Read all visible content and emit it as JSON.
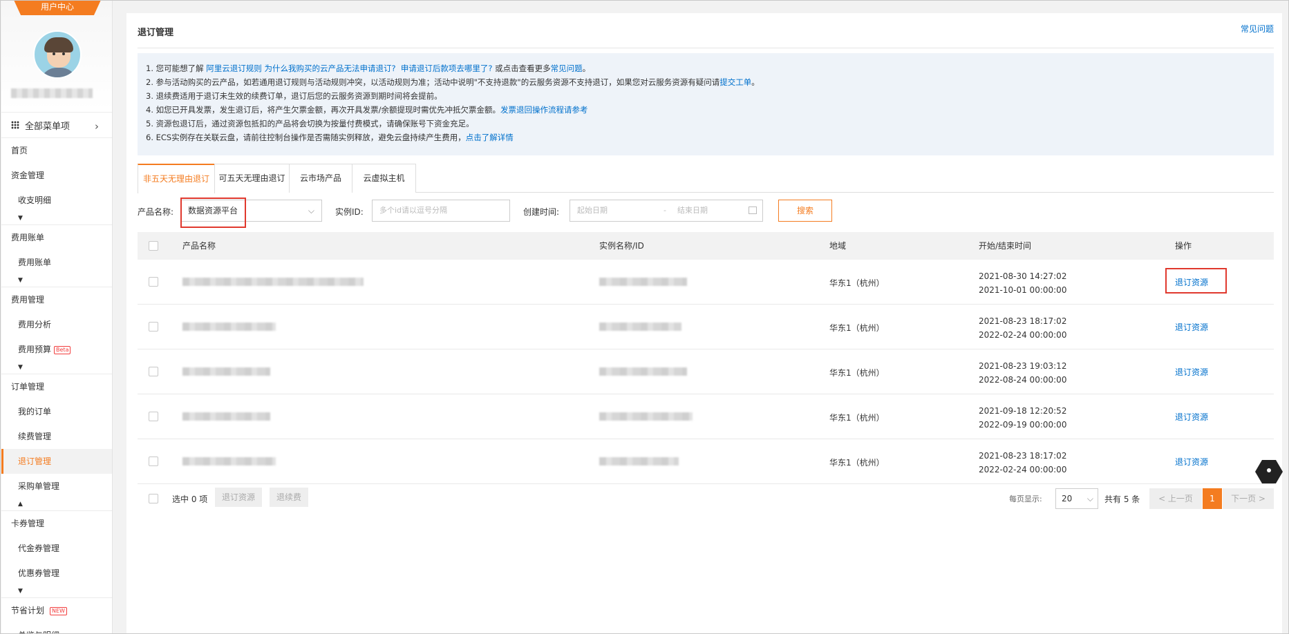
{
  "sidebar": {
    "user_center_label": "用户中心",
    "all_menu_label": "全部菜单项",
    "items": [
      {
        "label": "首页",
        "type": "top"
      },
      {
        "label": "资金管理",
        "type": "top"
      },
      {
        "label": "收支明细",
        "type": "sub"
      },
      {
        "label": "费用账单",
        "type": "top"
      },
      {
        "label": "费用账单",
        "type": "sub"
      },
      {
        "label": "费用管理",
        "type": "top"
      },
      {
        "label": "费用分析",
        "type": "sub"
      },
      {
        "label": "费用预算",
        "type": "sub",
        "badge": "Beta"
      },
      {
        "label": "订单管理",
        "type": "top"
      },
      {
        "label": "我的订单",
        "type": "sub"
      },
      {
        "label": "续费管理",
        "type": "sub"
      },
      {
        "label": "退订管理",
        "type": "sub",
        "active": true
      },
      {
        "label": "采购单管理",
        "type": "sub"
      },
      {
        "label": "卡券管理",
        "type": "top"
      },
      {
        "label": "代金券管理",
        "type": "sub"
      },
      {
        "label": "优惠券管理",
        "type": "sub"
      },
      {
        "label": "节省计划",
        "type": "top",
        "badge": "NEW"
      },
      {
        "label": "总览与明细",
        "type": "sub"
      }
    ]
  },
  "header": {
    "title": "退订管理",
    "faq_link": "常见问题"
  },
  "notice": {
    "line1_prefix": "1. 您可能想了解",
    "line1_link1": "阿里云退订规则",
    "line1_link2": "为什么我购买的云产品无法申请退订?",
    "line1_link3": "申请退订后款项去哪里了?",
    "line1_mid": "或点击查看更多",
    "line1_link4": "常见问题",
    "line1_end": "。",
    "line2_text": "2. 参与活动购买的云产品，如若通用退订规则与活动规则冲突，以活动规则为准；活动中说明\"不支持退款\"的云服务资源不支持退订，如果您对云服务资源有疑问请",
    "line2_link": "提交工单",
    "line2_end": "。",
    "line3_text": "3. 退续费适用于退订未生效的续费订单，退订后您的云服务资源到期时间将会提前。",
    "line4_text": "4. 如您已开具发票，发生退订后，将产生欠票金额，再次开具发票/余额提现时需优先冲抵欠票金额。",
    "line4_link": "发票退回操作流程请参考",
    "line5_text": "5. 资源包退订后，通过资源包抵扣的产品将会切换为按量付费模式，请确保账号下资金充足。",
    "line6_text": "6. ECS实例存在关联云盘，请前往控制台操作是否需随实例释放，避免云盘持续产生费用，",
    "line6_link": "点击了解详情"
  },
  "tabs": [
    {
      "label": "非五天无理由退订",
      "active": true
    },
    {
      "label": "可五天无理由退订"
    },
    {
      "label": "云市场产品"
    },
    {
      "label": "云虚拟主机"
    }
  ],
  "filters": {
    "product_label": "产品名称:",
    "product_value": "数据资源平台",
    "instance_label": "实例ID:",
    "instance_placeholder": "多个id请以逗号分隔",
    "created_label": "创建时间:",
    "start_placeholder": "起始日期",
    "date_separator": "-",
    "end_placeholder": "结束日期",
    "search_button": "搜索"
  },
  "table": {
    "columns": [
      "产品名称",
      "实例名称/ID",
      "地域",
      "开始/结束时间",
      "操作"
    ],
    "rows": [
      {
        "region": "华东1（杭州）",
        "start": "2021-08-30 14:27:02",
        "end": "2021-10-01 00:00:00",
        "action": "退订资源"
      },
      {
        "region": "华东1（杭州）",
        "start": "2021-08-23 18:17:02",
        "end": "2022-02-24 00:00:00",
        "action": "退订资源"
      },
      {
        "region": "华东1（杭州）",
        "start": "2021-08-23 19:03:12",
        "end": "2022-08-24 00:00:00",
        "action": "退订资源"
      },
      {
        "region": "华东1（杭州）",
        "start": "2021-09-18 12:20:52",
        "end": "2022-09-19 00:00:00",
        "action": "退订资源"
      },
      {
        "region": "华东1（杭州）",
        "start": "2021-08-23 18:17:02",
        "end": "2022-02-24 00:00:00",
        "action": "退订资源"
      }
    ]
  },
  "footer": {
    "selected": "选中 0 项",
    "unsubscribe_btn": "退订资源",
    "unrenew_btn": "退续费",
    "per_page_label": "每页显示:",
    "page_size": "20",
    "total": "共有 5 条",
    "prev": "< 上一页",
    "current_page": "1",
    "next": "下一页 >"
  },
  "colors": {
    "accent": "#f47c20",
    "link": "#0070cc",
    "highlight": "#e0382d"
  }
}
